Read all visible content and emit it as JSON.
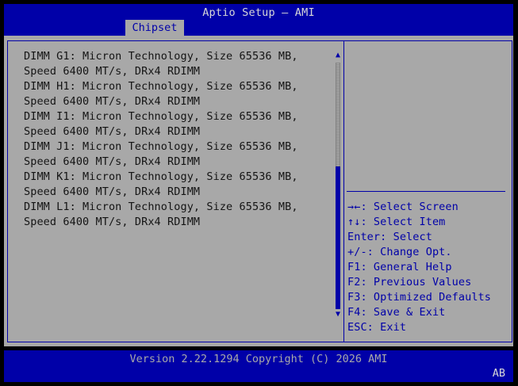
{
  "header": {
    "title": "Aptio Setup – AMI",
    "active_tab": "Chipset"
  },
  "content": {
    "lines": [
      "DIMM G1: Micron Technology, Size 65536 MB,",
      "Speed 6400 MT/s, DRx4 RDIMM",
      "DIMM H1: Micron Technology, Size 65536 MB,",
      "Speed 6400 MT/s, DRx4 RDIMM",
      "DIMM I1: Micron Technology, Size 65536 MB,",
      "Speed 6400 MT/s, DRx4 RDIMM",
      "DIMM J1: Micron Technology, Size 65536 MB,",
      "Speed 6400 MT/s, DRx4 RDIMM",
      "DIMM K1: Micron Technology, Size 65536 MB,",
      "Speed 6400 MT/s, DRx4 RDIMM",
      "DIMM L1: Micron Technology, Size 65536 MB,",
      "Speed 6400 MT/s, DRx4 RDIMM"
    ]
  },
  "scrollbar": {
    "up_icon": "triangle-up",
    "down_icon": "triangle-down",
    "thumb_start_fraction": 0.42,
    "thumb_end_fraction": 1.0
  },
  "help": {
    "items": [
      "→←: Select Screen",
      "↑↓: Select Item",
      "Enter: Select",
      "+/-: Change Opt.",
      "F1: General Help",
      "F2: Previous Values",
      "F3: Optimized Defaults",
      "F4: Save & Exit",
      "ESC: Exit"
    ]
  },
  "footer": {
    "version": "Version 2.22.1294 Copyright (C) 2026 AMI",
    "badge": "AB"
  },
  "colors": {
    "bios_blue": "#0000a8",
    "bios_gray": "#a8a8a8",
    "text_dark": "#141414"
  }
}
